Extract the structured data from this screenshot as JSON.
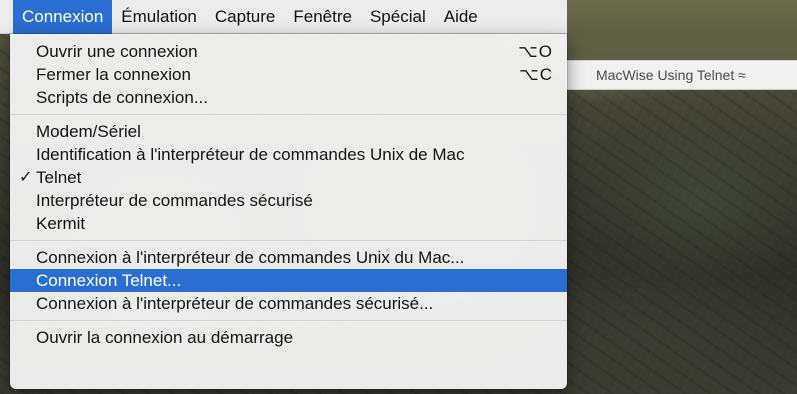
{
  "menubar": {
    "items": [
      {
        "label": "Connexion",
        "active": true
      },
      {
        "label": "Émulation"
      },
      {
        "label": "Capture"
      },
      {
        "label": "Fenêtre"
      },
      {
        "label": "Spécial"
      },
      {
        "label": "Aide"
      }
    ]
  },
  "background_window": {
    "title": "MacWise Using Telnet ≈"
  },
  "dropdown": {
    "items": [
      {
        "label": "Ouvrir une connexion",
        "shortcut": "⌥O"
      },
      {
        "label": "Fermer la connexion",
        "shortcut": "⌥C"
      },
      {
        "label": "Scripts de connexion..."
      },
      {
        "label": "Modem/Sériel"
      },
      {
        "label": "Identification à l'interpréteur de commandes Unix de Mac"
      },
      {
        "label": "Telnet",
        "checked": true,
        "check_glyph": "✓"
      },
      {
        "label": "Interpréteur de commandes sécurisé"
      },
      {
        "label": "Kermit"
      },
      {
        "label": "Connexion à l'interpréteur de commandes Unix du Mac..."
      },
      {
        "label": "Connexion Telnet...",
        "highlighted": true
      },
      {
        "label": "Connexion à l'interpréteur de commandes sécurisé..."
      },
      {
        "label": "Ouvrir la connexion au démarrage"
      }
    ]
  },
  "colors": {
    "highlight": "#2a6ed1",
    "menu_background": "#f6f6f6",
    "menubar_background": "#ececec"
  }
}
